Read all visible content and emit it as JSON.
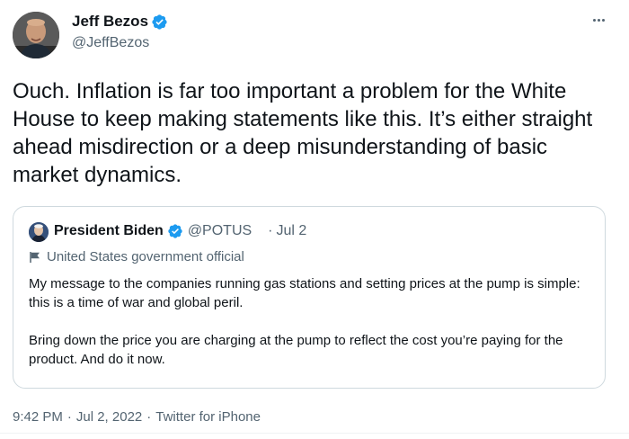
{
  "author": {
    "name": "Jeff Bezos",
    "handle": "@JeffBezos",
    "verified": true,
    "avatar_icon": "person-photo"
  },
  "tweet": {
    "text": "Ouch. Inflation is far too important a problem for the White House to keep making statements like this. It’s either straight ahead misdirection or a deep misunderstanding of basic market dynamics."
  },
  "quoted": {
    "name": "President Biden",
    "handle": "@POTUS",
    "separator": "·",
    "date": "Jul 2",
    "label": "United States government official",
    "paragraphs": [
      "My message to the companies running gas stations and setting prices at the pump is simple: this is a time of war and global peril.",
      "Bring down the price you are charging at the pump to reflect the cost you’re paying for the product. And do it now."
    ]
  },
  "meta": {
    "time": "9:42 PM",
    "separator": "·",
    "date": "Jul 2, 2022",
    "source": "Twitter for iPhone"
  },
  "colors": {
    "verified_blue": "#1d9bf0",
    "secondary_text": "#536471",
    "border": "#cfd9de"
  }
}
